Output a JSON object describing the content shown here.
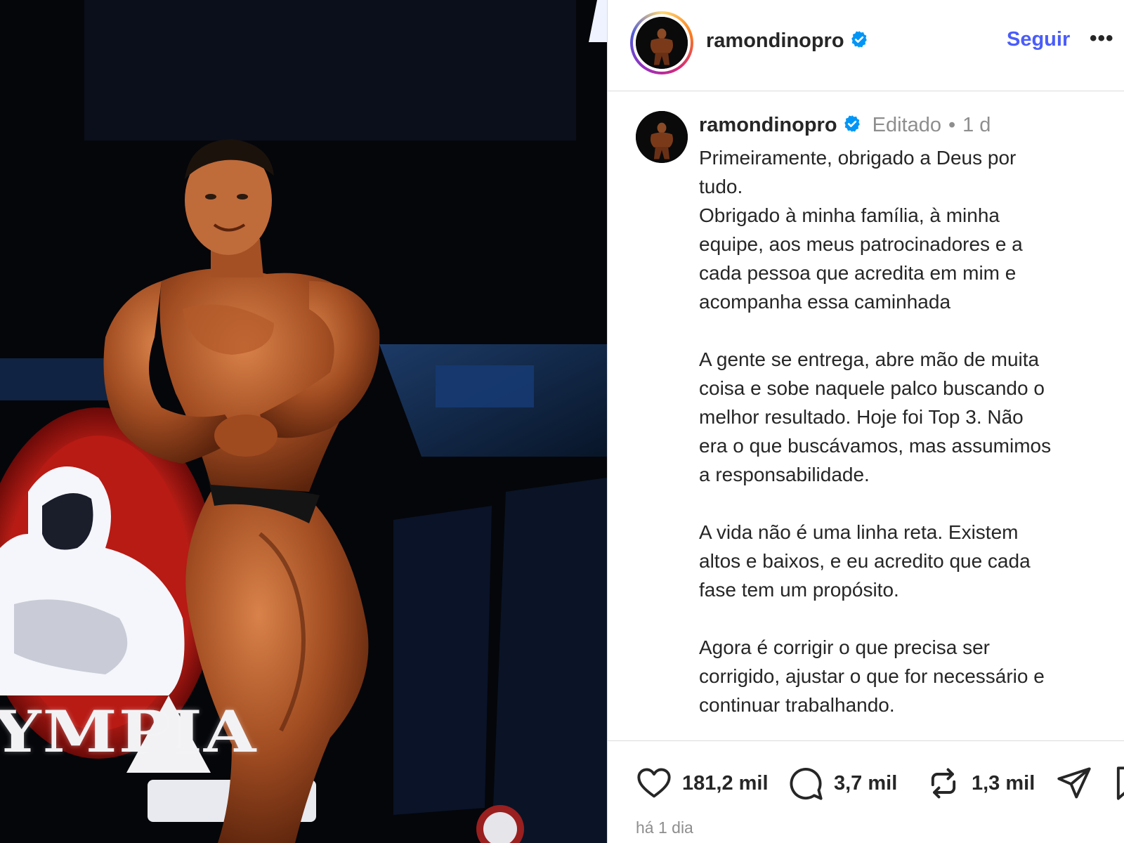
{
  "header": {
    "username": "ramondinopro",
    "follow_label": "Seguir",
    "more_label": "•••"
  },
  "caption": {
    "username": "ramondinopro",
    "edited_label": "Editado",
    "separator": "•",
    "age": "1 d",
    "text": "Primeiramente, obrigado a Deus por\ntudo.\nObrigado à minha família, à minha\nequipe, aos meus patrocinadores e a\ncada pessoa que acredita em mim e\nacompanha essa caminhada\n\nA gente se entrega, abre mão de muita\ncoisa e sobe naquele palco buscando o\nmelhor resultado. Hoje foi Top 3. Não\nera o que buscávamos, mas assumimos\na responsabilidade.\n\nA vida não é uma linha reta. Existem\naltos e baixos, e eu acredito que cada\nfase tem um propósito.\n\nAgora é corrigir o que precisa ser\ncorrigido, ajustar o que for necessário e\ncontinuar trabalhando."
  },
  "actions": {
    "likes": "181,2 mil",
    "comments": "3,7 mil",
    "reposts": "1,3 mil"
  },
  "timestamp": "há 1 dia",
  "media": {
    "stage_text": "YMPIA"
  },
  "colors": {
    "follow": "#4a5df9",
    "verified": "#0095f6",
    "muted": "#8e8e8e",
    "divider": "#dbdbdb"
  },
  "icons": {
    "verified": "verified-badge-icon",
    "like": "heart-icon",
    "comment": "comment-icon",
    "repost": "repost-icon",
    "share": "share-icon",
    "save": "bookmark-icon"
  }
}
